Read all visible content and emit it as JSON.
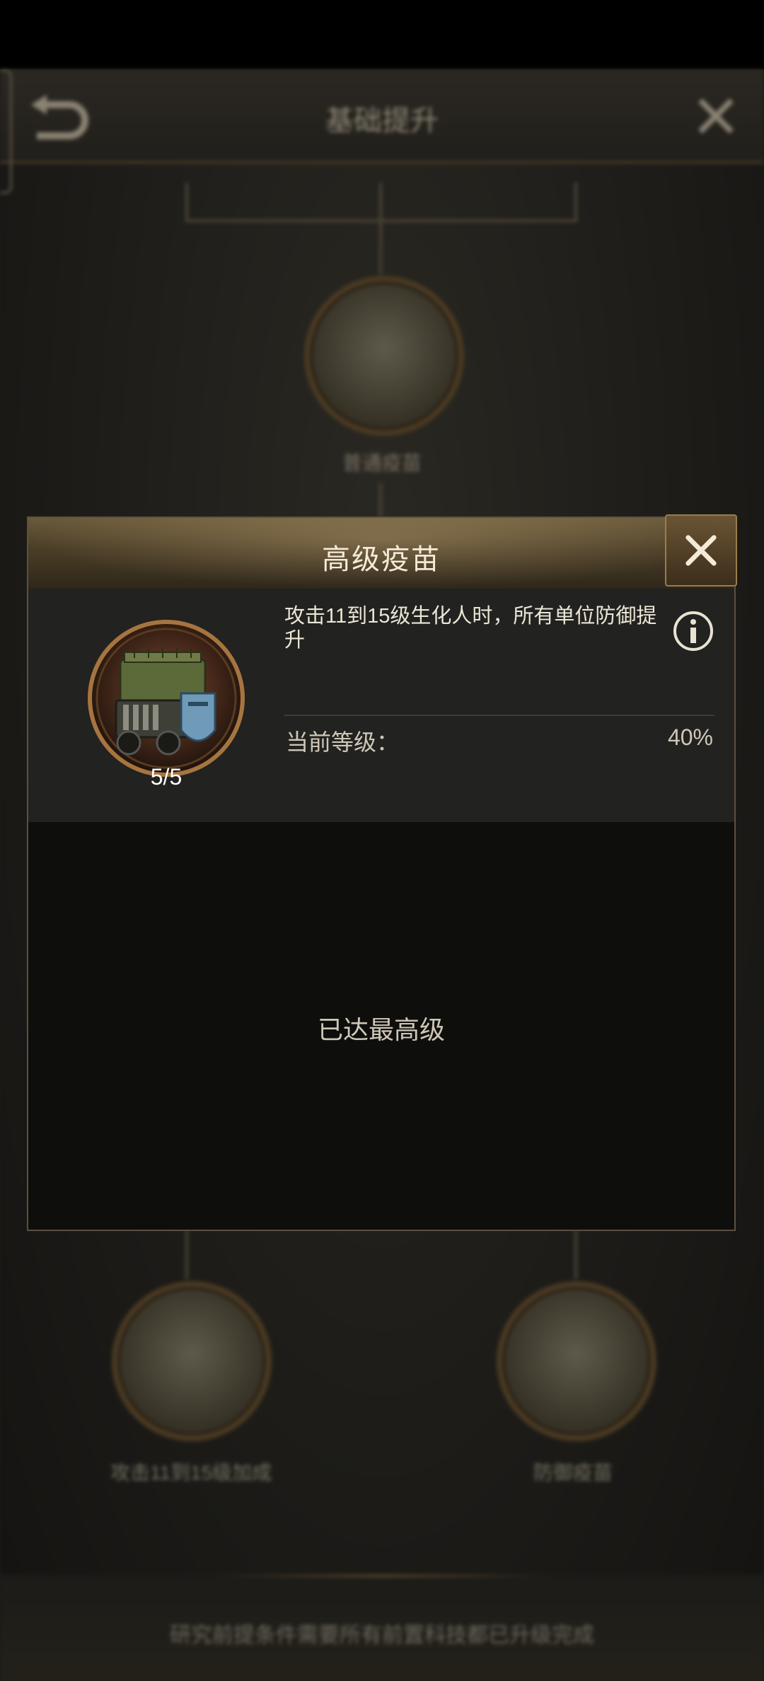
{
  "background": {
    "header_title": "基础提升",
    "node_top_label": "普通疫苗",
    "node_left_label": "攻击11到15级加成",
    "node_right_label": "防御疫苗",
    "footer_text": "研究前提条件需要所有前置科技都已升级完成"
  },
  "modal": {
    "title": "高级疫苗",
    "skill": {
      "level": "5/5",
      "description": "攻击11到15级生化人时，所有单位防御提升",
      "current_label": "当前等级：",
      "current_value": "40%"
    },
    "max_text": "已达最高级"
  },
  "colors": {
    "accent_gold": "#b08a4f",
    "modal_bg": "#0e0e0c",
    "panel_bg": "#222220"
  },
  "icons": [
    "back-arrow-icon",
    "close-icon",
    "info-icon",
    "armored-truck-icon"
  ]
}
